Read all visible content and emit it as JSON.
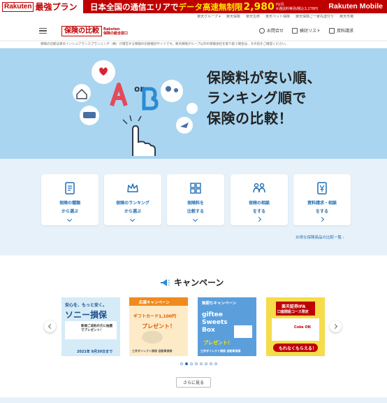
{
  "promo": {
    "badge": "Rakuten",
    "plan": "最強プラン",
    "main_white": "日本全国の通信エリアで",
    "main_yellow": "データ高速無制限",
    "price": "2,980",
    "price_unit": "円/月",
    "small_note": "※通話料等別/税込3,278円",
    "brand": "Rakuten Mobile"
  },
  "util_links": [
    "楽天グループ ▾",
    "楽天保険",
    "楽天生命",
    "楽天ペット保険",
    "楽天保険ご一家先送付り",
    "楽天市場"
  ],
  "header": {
    "logo_text": "保険の比較",
    "logo_sub1": "Rakuten",
    "logo_sub2": "保険の総合窓口",
    "nav": [
      {
        "label": "お問合せ",
        "icon": "question-icon"
      },
      {
        "label": "検討リスト",
        "icon": "list-icon"
      },
      {
        "label": "資料請求",
        "icon": "cart-icon"
      }
    ]
  },
  "disclaimer": "保険の比較は楽天インシュアランスプランニング（株）が運営する保険の比較検討サイトです。楽天保険グループ以外の保険会社を取り扱う場合は、その旨をご確認ください。",
  "hero": {
    "line1": "保険料が安い順、",
    "line2": "ランキング順で",
    "line3": "保険の比較！",
    "letter_a": "A",
    "letter_or": "or",
    "letter_b": "B"
  },
  "categories": [
    {
      "line1": "保険の種類",
      "line2": "から選ぶ",
      "icon": "document-icon",
      "chev": "down"
    },
    {
      "line1": "保険のランキング",
      "line2": "から選ぶ",
      "icon": "crown-icon",
      "chev": "down"
    },
    {
      "line1": "保険料を",
      "line2": "比較する",
      "icon": "grid-compare-icon",
      "chev": "down"
    },
    {
      "line1": "保険の相談",
      "line2": "をする",
      "icon": "consult-icon",
      "chev": "right"
    },
    {
      "line1": "資料請求・相談",
      "line2": "をする",
      "icon": "yen-doc-icon",
      "chev": "right"
    }
  ],
  "cats_link": "お得な保険商品の比較一覧",
  "campaign": {
    "title": "キャンペーン",
    "banners": [
      {
        "top": "安心を、もっと安く。",
        "main": "ソニー損保",
        "sub": "新規ご成約の方に抽選でプレゼント！",
        "date": "2021年 9月30日まで",
        "bg": "#d5ebf7"
      },
      {
        "top": "応募キャンペーン",
        "main": "ギフトカード1,100円",
        "sub": "プレゼント！",
        "foot": "三井ダイレクト損保 自動車保険",
        "bg": "#fdebc7"
      },
      {
        "top": "無期ちキャンペーン",
        "main": "giftee Sweets Box",
        "sub": "プレゼント！",
        "foot": "三井ダイレクト損保 自動車保険",
        "bg": "#5a9fdc"
      },
      {
        "top": "楽天証券IFA",
        "main": "口座開設コース限定",
        "sub": "もれなくもらえる！",
        "foot": "Coke ON",
        "bg": "#f5dc4a"
      }
    ],
    "more_label": "さらに見る"
  }
}
